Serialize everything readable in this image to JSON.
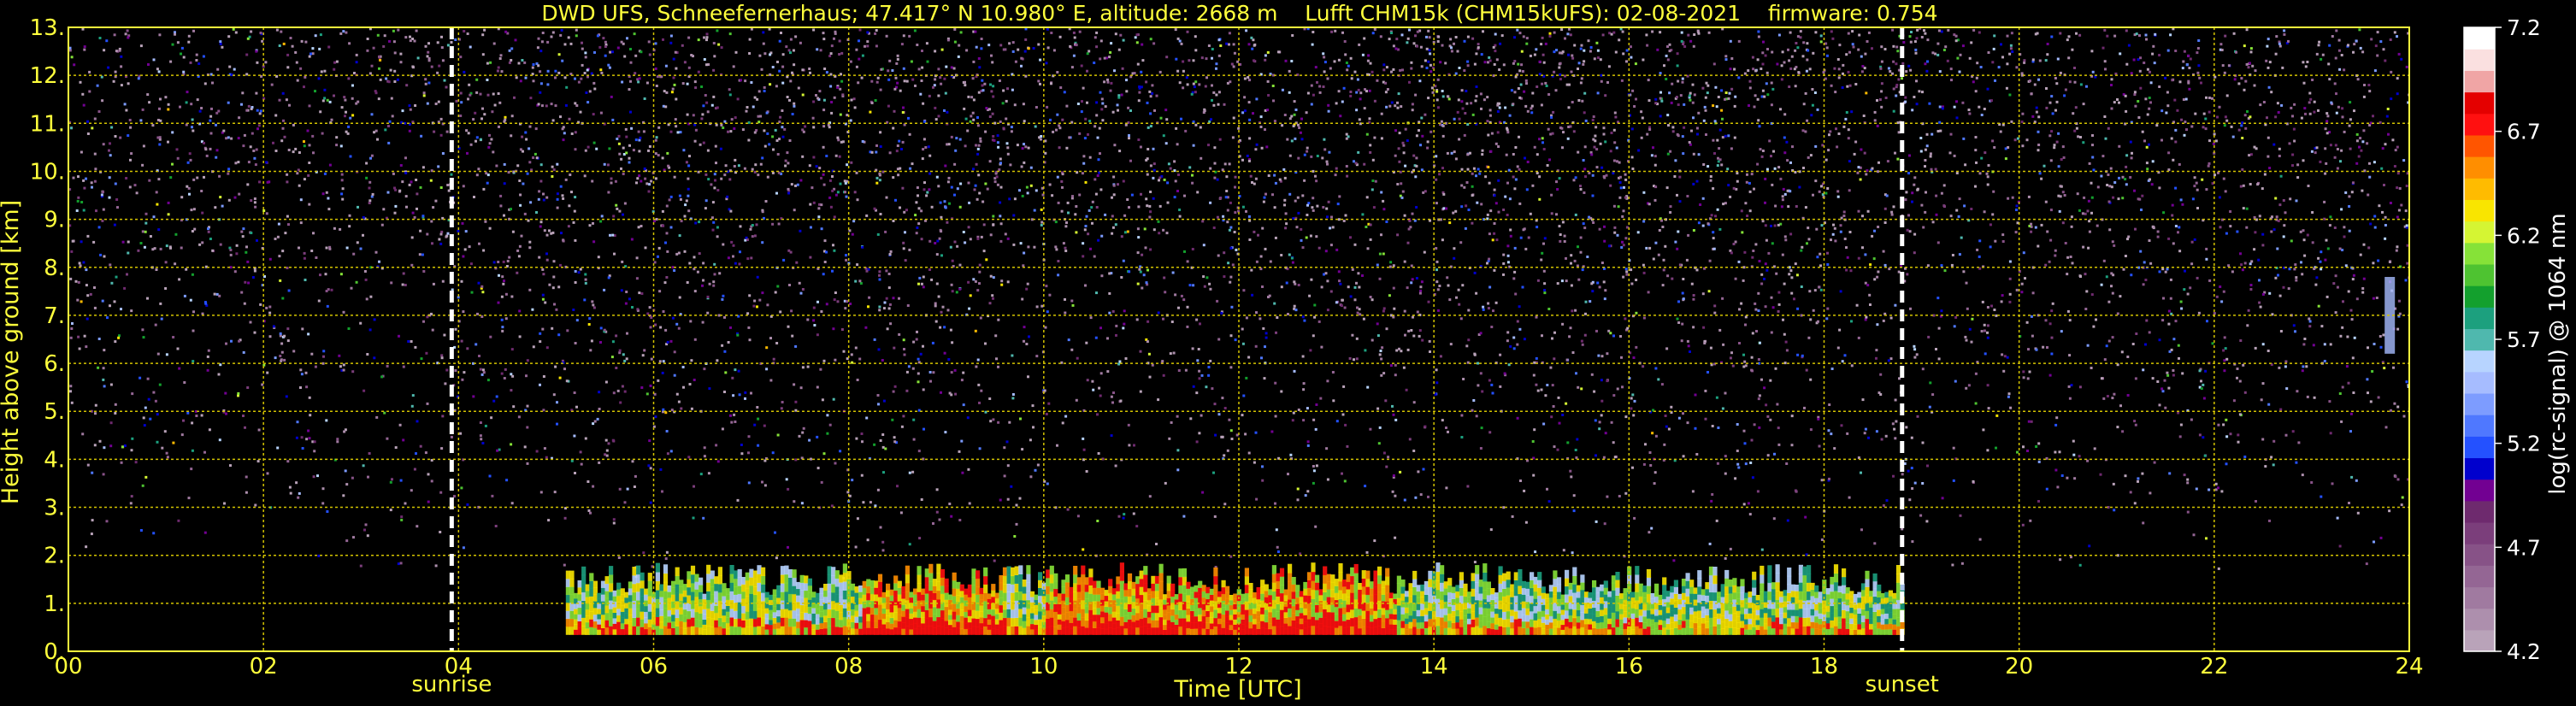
{
  "chart_data": {
    "type": "heatmap",
    "title": "DWD UFS, Schneefernerhaus; 47.417° N 10.980° E, altitude: 2668 m    Lufft CHM15k (CHM15kUFS): 02-08-2021    firmware: 0.754",
    "xlabel": "Time [UTC]",
    "ylabel": "Height above ground [km]",
    "xlim": [
      0,
      24
    ],
    "ylim": [
      0,
      13
    ],
    "x_ticks": [
      "00",
      "02",
      "04",
      "06",
      "08",
      "10",
      "12",
      "14",
      "16",
      "18",
      "20",
      "22",
      "24"
    ],
    "y_ticks": [
      "0.",
      "1.",
      "2.",
      "3.",
      "4.",
      "5.",
      "6.",
      "7.",
      "8.",
      "9.",
      "10.",
      "11.",
      "12.",
      "13."
    ],
    "grid": true,
    "markers": [
      {
        "label": "sunrise",
        "x": 3.93
      },
      {
        "label": "sunset",
        "x": 18.8
      }
    ],
    "colorbar": {
      "label": "log(rc-signal) @ 1064 nm",
      "min": 4.2,
      "max": 7.2,
      "ticks": [
        "4.2",
        "4.7",
        "5.2",
        "5.7",
        "6.2",
        "6.7",
        "7.2"
      ],
      "colors": [
        "#b9a3b9",
        "#ad8fad",
        "#a07aa0",
        "#946694",
        "#875287",
        "#7b3e7b",
        "#6e2a6e",
        "#720092",
        "#0000cd",
        "#2451ff",
        "#4f78ff",
        "#7d9cff",
        "#a6bcff",
        "#b7d4ff",
        "#4fb8ae",
        "#1ca07e",
        "#13a02d",
        "#4ec331",
        "#86e238",
        "#d5f533",
        "#f9e500",
        "#ffbb00",
        "#ff8e00",
        "#ff5500",
        "#ff1010",
        "#e40000",
        "#f0a5a5",
        "#fae0e0",
        "#ffffff"
      ]
    },
    "layers": [
      {
        "name": "aerosol_layer",
        "x_start": 5.1,
        "x_end": 18.8,
        "y_bottom": 0.35,
        "y_top": 1.85
      },
      {
        "name": "noise_region",
        "x_start": 0,
        "x_end": 24,
        "y_bottom": 1.5,
        "y_top": 13
      },
      {
        "name": "outlier_patch",
        "x": 23.8,
        "y_bottom": 6.2,
        "y_top": 7.8
      }
    ]
  }
}
